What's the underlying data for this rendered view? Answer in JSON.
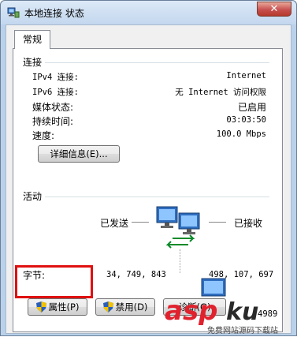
{
  "window": {
    "title": "本地连接 状态",
    "close_label": "✕"
  },
  "tabs": [
    {
      "label": "常规"
    }
  ],
  "connection": {
    "section_label": "连接",
    "rows": [
      {
        "label": "IPv4 连接:",
        "value": "Internet"
      },
      {
        "label": "IPv6 连接:",
        "value": "无 Internet 访问权限"
      },
      {
        "label": "媒体状态:",
        "value": "已启用"
      },
      {
        "label": "持续时间:",
        "value": "03:03:50"
      },
      {
        "label": "速度:",
        "value": "100.0 Mbps"
      }
    ],
    "details_button": "详细信息(E)..."
  },
  "activity": {
    "section_label": "活动",
    "sent_label": "已发送",
    "received_label": "已接收",
    "bytes_label": "字节:",
    "bytes_sent": "34, 749, 843",
    "bytes_received": "498, 107, 697"
  },
  "buttons": {
    "properties": "属性(P)",
    "disable": "禁用(D)",
    "diagnose": "诊断(G)",
    "partial_value": "4989"
  },
  "watermark": {
    "brand": "asp",
    "brand_suffix": "ku",
    "tagline": "免费网站源码下载站"
  },
  "colors": {
    "highlight": "#e01010",
    "watermark_red": "#e0222e",
    "shield_blue": "#2a5fb8",
    "shield_yellow": "#f2c200"
  }
}
